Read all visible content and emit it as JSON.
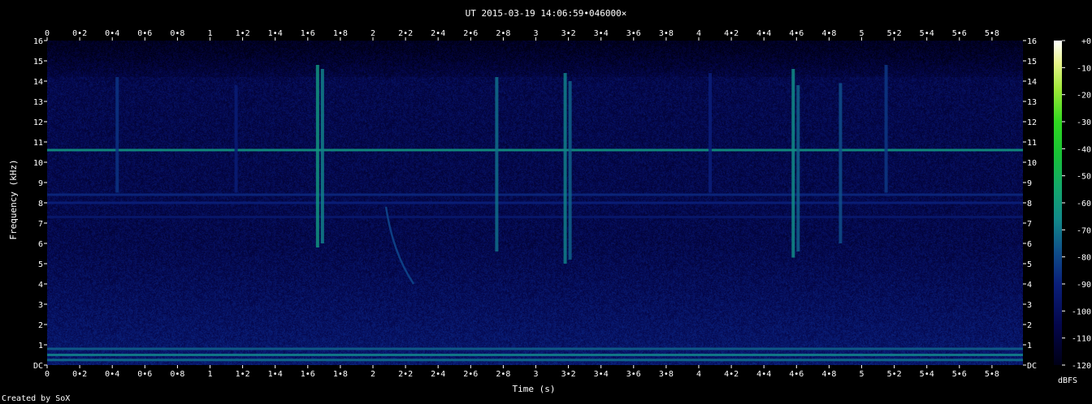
{
  "chart_data": {
    "type": "heatmap",
    "title": "UT 2015-03-19 14:06:59•046000×",
    "xlabel": "Time (s)",
    "ylabel": "Frequency (kHz)",
    "xlim": [
      0,
      5.99
    ],
    "ylim": [
      0,
      16
    ],
    "x_ticks": [
      "0",
      "0•2",
      "0•4",
      "0•6",
      "0•8",
      "1",
      "1•2",
      "1•4",
      "1•6",
      "1•8",
      "2",
      "2•2",
      "2•4",
      "2•6",
      "2•8",
      "3",
      "3•2",
      "3•4",
      "3•6",
      "3•8",
      "4",
      "4•2",
      "4•4",
      "4•6",
      "4•8",
      "5",
      "5•2",
      "5•4",
      "5•6",
      "5•8"
    ],
    "x_tick_values": [
      0,
      0.2,
      0.4,
      0.6,
      0.8,
      1,
      1.2,
      1.4,
      1.6,
      1.8,
      2,
      2.2,
      2.4,
      2.6,
      2.8,
      3,
      3.2,
      3.4,
      3.6,
      3.8,
      4,
      4.2,
      4.4,
      4.6,
      4.8,
      5,
      5.2,
      5.4,
      5.6,
      5.8
    ],
    "y_ticks": [
      "DC",
      "1",
      "2",
      "3",
      "4",
      "5",
      "6",
      "7",
      "8",
      "9",
      "10",
      "11",
      "12",
      "13",
      "14",
      "15",
      "16"
    ],
    "y_tick_values": [
      0,
      1,
      2,
      3,
      4,
      5,
      6,
      7,
      8,
      9,
      10,
      11,
      12,
      13,
      14,
      15,
      16
    ],
    "colorbar": {
      "label": "dBFS",
      "ticks": [
        "+0",
        "-10",
        "-20",
        "-30",
        "-40",
        "-50",
        "-60",
        "-70",
        "-80",
        "-90",
        "-100",
        "-110",
        "-120"
      ],
      "tick_values": [
        0,
        -10,
        -20,
        -30,
        -40,
        -50,
        -60,
        -70,
        -80,
        -90,
        -100,
        -110,
        -120
      ],
      "range": [
        -120,
        0
      ]
    },
    "colors": {
      "background": "#000000",
      "low": "#000022",
      "mid": "#0f4f8a",
      "high": "#1bbfa0",
      "peak": "#ffffff"
    },
    "features": {
      "horizontal_lines": [
        {
          "freq_khz": 10.6,
          "dbfs": -62
        },
        {
          "freq_khz": 8.4,
          "dbfs": -88
        },
        {
          "freq_khz": 8.0,
          "dbfs": -90
        },
        {
          "freq_khz": 7.3,
          "dbfs": -95
        },
        {
          "freq_khz": 0.8,
          "dbfs": -75
        },
        {
          "freq_khz": 0.5,
          "dbfs": -68
        },
        {
          "freq_khz": 0.25,
          "dbfs": -72
        }
      ],
      "vertical_bursts": [
        {
          "time_s": 0.43,
          "fmin_khz": 8.5,
          "fmax_khz": 14.2,
          "dbfs": -85
        },
        {
          "time_s": 1.16,
          "fmin_khz": 8.5,
          "fmax_khz": 13.8,
          "dbfs": -92
        },
        {
          "time_s": 1.66,
          "fmin_khz": 5.8,
          "fmax_khz": 14.8,
          "dbfs": -62
        },
        {
          "time_s": 1.69,
          "fmin_khz": 6.0,
          "fmax_khz": 14.6,
          "dbfs": -68
        },
        {
          "time_s": 2.76,
          "fmin_khz": 5.6,
          "fmax_khz": 14.2,
          "dbfs": -72
        },
        {
          "time_s": 3.18,
          "fmin_khz": 5.0,
          "fmax_khz": 14.4,
          "dbfs": -68
        },
        {
          "time_s": 3.21,
          "fmin_khz": 5.2,
          "fmax_khz": 14.0,
          "dbfs": -74
        },
        {
          "time_s": 4.07,
          "fmin_khz": 8.5,
          "fmax_khz": 14.4,
          "dbfs": -90
        },
        {
          "time_s": 4.58,
          "fmin_khz": 5.3,
          "fmax_khz": 14.6,
          "dbfs": -65
        },
        {
          "time_s": 4.61,
          "fmin_khz": 5.6,
          "fmax_khz": 13.8,
          "dbfs": -74
        },
        {
          "time_s": 4.87,
          "fmin_khz": 6.0,
          "fmax_khz": 13.9,
          "dbfs": -78
        },
        {
          "time_s": 5.15,
          "fmin_khz": 8.5,
          "fmax_khz": 14.8,
          "dbfs": -84
        }
      ],
      "chirp": {
        "t_start_s": 2.08,
        "f_start_khz": 7.8,
        "t_end_s": 2.25,
        "f_end_khz": 4.0,
        "dbfs": -82
      }
    }
  },
  "footer": {
    "credit": "Created by SoX"
  }
}
